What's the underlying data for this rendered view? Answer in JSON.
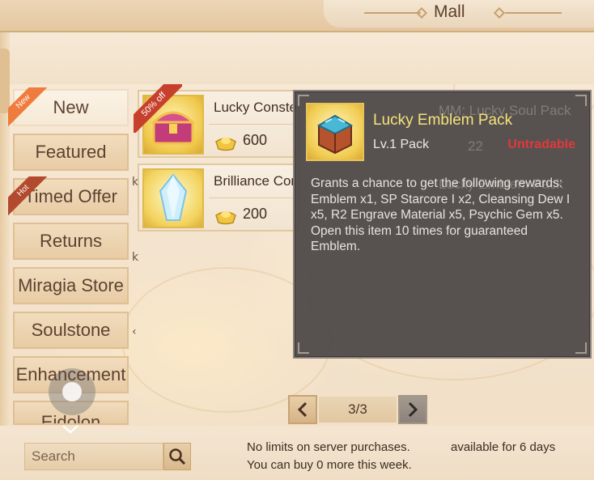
{
  "header": {
    "title": "Mall"
  },
  "categories": [
    {
      "label": "New",
      "badge": "New",
      "active": true
    },
    {
      "label": "Featured"
    },
    {
      "label": "Timed Offer",
      "badge": "Hot"
    },
    {
      "label": "Returns"
    },
    {
      "label": "Miragia Store"
    },
    {
      "label": "Soulstone"
    },
    {
      "label": "Enhancement"
    },
    {
      "label": "Eidolon"
    }
  ],
  "side_marks": [
    "k",
    "k",
    "‹"
  ],
  "items": [
    {
      "name": "Lucky Conste",
      "price": "600",
      "badge": "50% off"
    },
    {
      "name": "Brilliance Cor",
      "price": "200"
    }
  ],
  "obscured_items": [
    {
      "name": "MM: Lucky Soul Pack",
      "price": "22"
    },
    {
      "name": "Lucky Emblem Pack"
    }
  ],
  "tooltip": {
    "name": "Lucky Emblem Pack",
    "level": "Lv.1 Pack",
    "status": "Untradable",
    "description": "Grants a chance to get the following rewards: Emblem x1, SP Starcore I x2, Cleansing Dew I x5, R2 Engrave Material x5, Psychic Gem x5. Open this item 10 times for guaranteed Emblem."
  },
  "pagination": {
    "label": "3/3",
    "prev_icon": "chevron-left-icon",
    "next_icon": "chevron-right-icon"
  },
  "search": {
    "placeholder": "Search"
  },
  "info": {
    "server_limit": "No limits on server purchases.",
    "availability": "available for 6 days",
    "weekly": "You can buy 0 more this week."
  },
  "colors": {
    "tooltip_title": "#f4e27a",
    "untradable": "#e2383a",
    "sale_ribbon": "#c6402d",
    "new_ribbon": "#ef7b3c"
  }
}
